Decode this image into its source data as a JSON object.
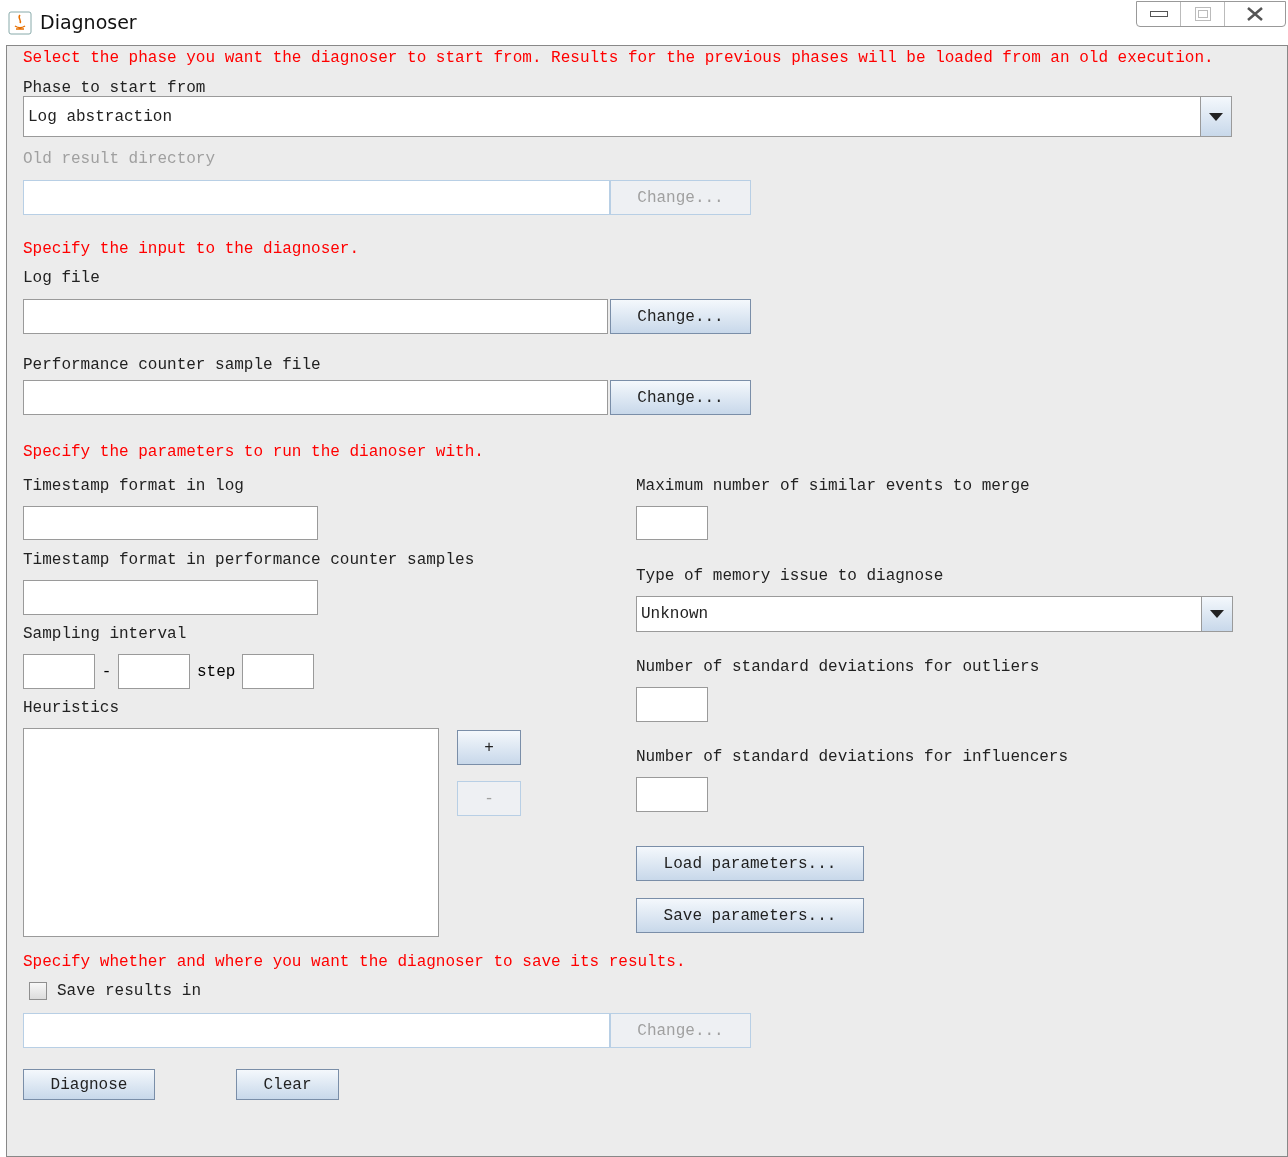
{
  "window": {
    "title": "Diagnoser"
  },
  "phase": {
    "instruction": "Select the phase you want the diagnoser to start from. Results for the previous phases will be loaded from an old execution.",
    "label": "Phase to start from",
    "value": "Log abstraction",
    "old_dir": {
      "label": "Old result directory",
      "disabled": true,
      "button": "Change..."
    }
  },
  "input": {
    "instruction": "Specify the input to the diagnoser.",
    "files": [
      {
        "label": "Log file",
        "disabled": false,
        "button": "Change..."
      },
      {
        "label": "Performance counter sample file",
        "disabled": false,
        "button": "Change..."
      }
    ]
  },
  "parameters": {
    "instruction": "Specify the parameters to run the dianoser with.",
    "timestamp_log_label": "Timestamp format in log",
    "timestamp_perf_label": "Timestamp format in performance counter samples",
    "sampling_label": "Sampling interval",
    "range_separator": "-",
    "step_label": "step",
    "heuristics_label": "Heuristics",
    "add_button": {
      "label": "+",
      "disabled": false
    },
    "remove_button": {
      "label": "-",
      "disabled": true
    },
    "max_events_label": "Maximum number of similar events to merge",
    "memory_issue_label": "Type of memory issue to diagnose",
    "memory_issue_value": "Unknown",
    "outliers_label": "Number of standard deviations for outliers",
    "influencers_label": "Number of standard deviations for influencers",
    "load_button": "Load parameters...",
    "save_button": "Save parameters..."
  },
  "output": {
    "instruction": "Specify whether and where you want the diagnoser to save its results.",
    "save_checkbox": {
      "label": "Save results in",
      "checked": false
    },
    "button": {
      "label": "Change...",
      "disabled": true
    }
  },
  "actions": [
    "Diagnose",
    "Clear"
  ]
}
